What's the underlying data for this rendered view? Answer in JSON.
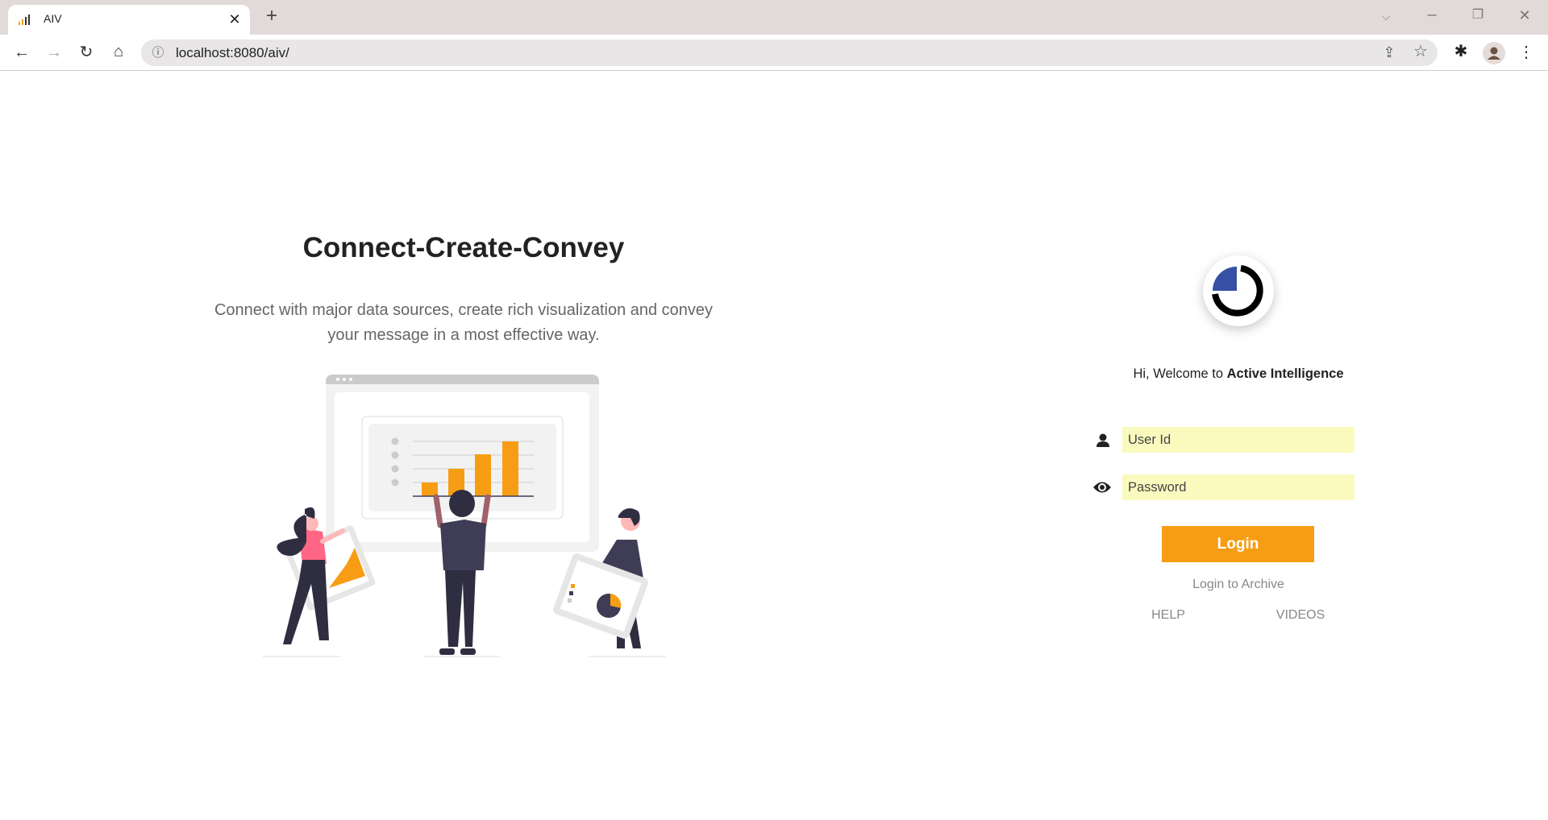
{
  "browser": {
    "tab_title": "AIV",
    "url": "localhost:8080/aiv/",
    "icons": [
      "bar-chart-favicon",
      "close-icon",
      "plus-icon",
      "back-icon",
      "forward-icon",
      "reload-icon",
      "home-icon",
      "info-icon",
      "share-icon",
      "star-icon",
      "extensions-icon",
      "profile-icon",
      "menu-icon",
      "chevron-down-icon",
      "minimize-icon",
      "restore-icon",
      "window-close-icon"
    ]
  },
  "hero": {
    "title": "Connect-Create-Convey",
    "subtitle_line1": "Connect with major data sources, create rich visualization and convey",
    "subtitle_line2": "your message in a most effective way."
  },
  "login": {
    "welcome_prefix": "Hi, Welcome to ",
    "welcome_brand": "Active Intelligence",
    "user_placeholder": "User Id",
    "password_placeholder": "Password",
    "login_label": "Login",
    "archive_label": "Login to Archive",
    "help_label": "HELP",
    "videos_label": "VIDEOS"
  },
  "colors": {
    "accent": "#f79d14",
    "logo_blue": "#3650a5",
    "input_bg": "#fafabf"
  }
}
